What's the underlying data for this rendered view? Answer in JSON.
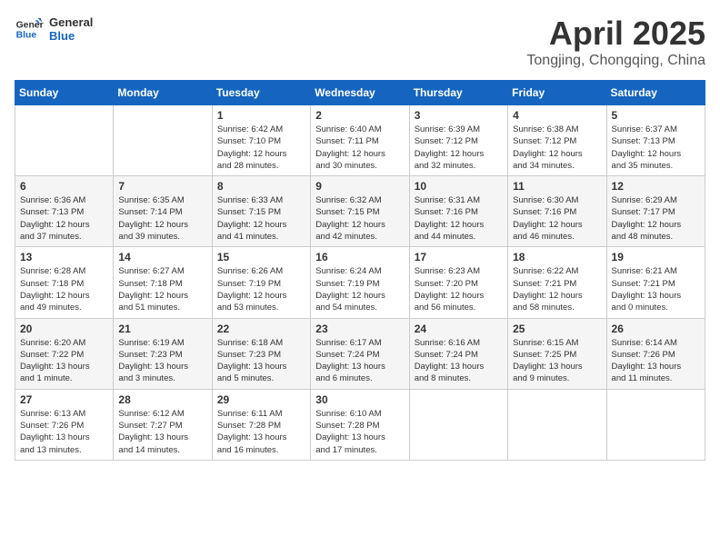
{
  "logo": {
    "line1": "General",
    "line2": "Blue"
  },
  "title": "April 2025",
  "location": "Tongjing, Chongqing, China",
  "weekdays": [
    "Sunday",
    "Monday",
    "Tuesday",
    "Wednesday",
    "Thursday",
    "Friday",
    "Saturday"
  ],
  "weeks": [
    [
      {
        "day": "",
        "info": ""
      },
      {
        "day": "",
        "info": ""
      },
      {
        "day": "1",
        "info": "Sunrise: 6:42 AM\nSunset: 7:10 PM\nDaylight: 12 hours\nand 28 minutes."
      },
      {
        "day": "2",
        "info": "Sunrise: 6:40 AM\nSunset: 7:11 PM\nDaylight: 12 hours\nand 30 minutes."
      },
      {
        "day": "3",
        "info": "Sunrise: 6:39 AM\nSunset: 7:12 PM\nDaylight: 12 hours\nand 32 minutes."
      },
      {
        "day": "4",
        "info": "Sunrise: 6:38 AM\nSunset: 7:12 PM\nDaylight: 12 hours\nand 34 minutes."
      },
      {
        "day": "5",
        "info": "Sunrise: 6:37 AM\nSunset: 7:13 PM\nDaylight: 12 hours\nand 35 minutes."
      }
    ],
    [
      {
        "day": "6",
        "info": "Sunrise: 6:36 AM\nSunset: 7:13 PM\nDaylight: 12 hours\nand 37 minutes."
      },
      {
        "day": "7",
        "info": "Sunrise: 6:35 AM\nSunset: 7:14 PM\nDaylight: 12 hours\nand 39 minutes."
      },
      {
        "day": "8",
        "info": "Sunrise: 6:33 AM\nSunset: 7:15 PM\nDaylight: 12 hours\nand 41 minutes."
      },
      {
        "day": "9",
        "info": "Sunrise: 6:32 AM\nSunset: 7:15 PM\nDaylight: 12 hours\nand 42 minutes."
      },
      {
        "day": "10",
        "info": "Sunrise: 6:31 AM\nSunset: 7:16 PM\nDaylight: 12 hours\nand 44 minutes."
      },
      {
        "day": "11",
        "info": "Sunrise: 6:30 AM\nSunset: 7:16 PM\nDaylight: 12 hours\nand 46 minutes."
      },
      {
        "day": "12",
        "info": "Sunrise: 6:29 AM\nSunset: 7:17 PM\nDaylight: 12 hours\nand 48 minutes."
      }
    ],
    [
      {
        "day": "13",
        "info": "Sunrise: 6:28 AM\nSunset: 7:18 PM\nDaylight: 12 hours\nand 49 minutes."
      },
      {
        "day": "14",
        "info": "Sunrise: 6:27 AM\nSunset: 7:18 PM\nDaylight: 12 hours\nand 51 minutes."
      },
      {
        "day": "15",
        "info": "Sunrise: 6:26 AM\nSunset: 7:19 PM\nDaylight: 12 hours\nand 53 minutes."
      },
      {
        "day": "16",
        "info": "Sunrise: 6:24 AM\nSunset: 7:19 PM\nDaylight: 12 hours\nand 54 minutes."
      },
      {
        "day": "17",
        "info": "Sunrise: 6:23 AM\nSunset: 7:20 PM\nDaylight: 12 hours\nand 56 minutes."
      },
      {
        "day": "18",
        "info": "Sunrise: 6:22 AM\nSunset: 7:21 PM\nDaylight: 12 hours\nand 58 minutes."
      },
      {
        "day": "19",
        "info": "Sunrise: 6:21 AM\nSunset: 7:21 PM\nDaylight: 13 hours\nand 0 minutes."
      }
    ],
    [
      {
        "day": "20",
        "info": "Sunrise: 6:20 AM\nSunset: 7:22 PM\nDaylight: 13 hours\nand 1 minute."
      },
      {
        "day": "21",
        "info": "Sunrise: 6:19 AM\nSunset: 7:23 PM\nDaylight: 13 hours\nand 3 minutes."
      },
      {
        "day": "22",
        "info": "Sunrise: 6:18 AM\nSunset: 7:23 PM\nDaylight: 13 hours\nand 5 minutes."
      },
      {
        "day": "23",
        "info": "Sunrise: 6:17 AM\nSunset: 7:24 PM\nDaylight: 13 hours\nand 6 minutes."
      },
      {
        "day": "24",
        "info": "Sunrise: 6:16 AM\nSunset: 7:24 PM\nDaylight: 13 hours\nand 8 minutes."
      },
      {
        "day": "25",
        "info": "Sunrise: 6:15 AM\nSunset: 7:25 PM\nDaylight: 13 hours\nand 9 minutes."
      },
      {
        "day": "26",
        "info": "Sunrise: 6:14 AM\nSunset: 7:26 PM\nDaylight: 13 hours\nand 11 minutes."
      }
    ],
    [
      {
        "day": "27",
        "info": "Sunrise: 6:13 AM\nSunset: 7:26 PM\nDaylight: 13 hours\nand 13 minutes."
      },
      {
        "day": "28",
        "info": "Sunrise: 6:12 AM\nSunset: 7:27 PM\nDaylight: 13 hours\nand 14 minutes."
      },
      {
        "day": "29",
        "info": "Sunrise: 6:11 AM\nSunset: 7:28 PM\nDaylight: 13 hours\nand 16 minutes."
      },
      {
        "day": "30",
        "info": "Sunrise: 6:10 AM\nSunset: 7:28 PM\nDaylight: 13 hours\nand 17 minutes."
      },
      {
        "day": "",
        "info": ""
      },
      {
        "day": "",
        "info": ""
      },
      {
        "day": "",
        "info": ""
      }
    ]
  ]
}
